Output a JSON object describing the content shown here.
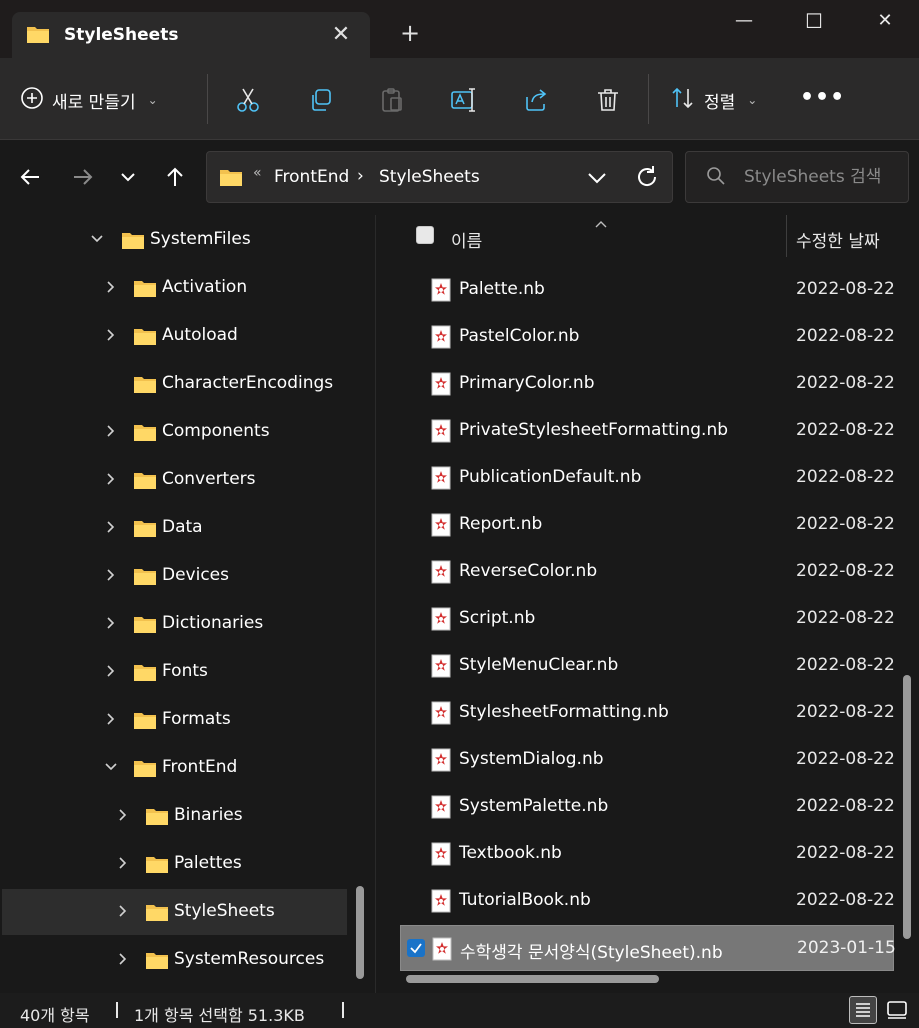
{
  "window": {
    "tab_title": "StyleSheets",
    "tab_close": "✕",
    "new_tab": "+",
    "minimize": "—",
    "maximize": "☐",
    "close": "✕"
  },
  "toolbar": {
    "new_label": "새로 만들기",
    "sort_label": "정렬",
    "more_label": "•••"
  },
  "address": {
    "chevron": "«",
    "crumbs": [
      "FrontEnd",
      "StyleSheets"
    ],
    "separator": "›"
  },
  "search": {
    "placeholder": "StyleSheets 검색"
  },
  "nav_tree": [
    {
      "label": "SystemFiles",
      "level": 0,
      "expanded": true
    },
    {
      "label": "Activation",
      "level": 1,
      "expanded": false
    },
    {
      "label": "Autoload",
      "level": 1,
      "expanded": false
    },
    {
      "label": "CharacterEncodings",
      "level": 1,
      "expanded": null
    },
    {
      "label": "Components",
      "level": 1,
      "expanded": false
    },
    {
      "label": "Converters",
      "level": 1,
      "expanded": false
    },
    {
      "label": "Data",
      "level": 1,
      "expanded": false
    },
    {
      "label": "Devices",
      "level": 1,
      "expanded": false
    },
    {
      "label": "Dictionaries",
      "level": 1,
      "expanded": false
    },
    {
      "label": "Fonts",
      "level": 1,
      "expanded": false
    },
    {
      "label": "Formats",
      "level": 1,
      "expanded": false
    },
    {
      "label": "FrontEnd",
      "level": 1,
      "expanded": true
    },
    {
      "label": "Binaries",
      "level": 2,
      "expanded": false
    },
    {
      "label": "Palettes",
      "level": 2,
      "expanded": false
    },
    {
      "label": "StyleSheets",
      "level": 2,
      "expanded": false,
      "selected": true
    },
    {
      "label": "SystemResources",
      "level": 2,
      "expanded": false
    }
  ],
  "columns": {
    "name": "이름",
    "date": "수정한 날짜"
  },
  "files": [
    {
      "name": "Palette.nb",
      "date": "2022-08-22"
    },
    {
      "name": "PastelColor.nb",
      "date": "2022-08-22"
    },
    {
      "name": "PrimaryColor.nb",
      "date": "2022-08-22"
    },
    {
      "name": "PrivateStylesheetFormatting.nb",
      "date": "2022-08-22"
    },
    {
      "name": "PublicationDefault.nb",
      "date": "2022-08-22"
    },
    {
      "name": "Report.nb",
      "date": "2022-08-22"
    },
    {
      "name": "ReverseColor.nb",
      "date": "2022-08-22"
    },
    {
      "name": "Script.nb",
      "date": "2022-08-22"
    },
    {
      "name": "StyleMenuClear.nb",
      "date": "2022-08-22"
    },
    {
      "name": "StylesheetFormatting.nb",
      "date": "2022-08-22"
    },
    {
      "name": "SystemDialog.nb",
      "date": "2022-08-22"
    },
    {
      "name": "SystemPalette.nb",
      "date": "2022-08-22"
    },
    {
      "name": "Textbook.nb",
      "date": "2022-08-22"
    },
    {
      "name": "TutorialBook.nb",
      "date": "2022-08-22"
    },
    {
      "name": "수학생각 문서양식(StyleSheet).nb",
      "date": "2023-01-15",
      "selected": true
    }
  ],
  "status": {
    "item_count": "40개 항목",
    "selection": "1개 항목 선택함 51.3KB"
  },
  "colors": {
    "folder": "#f2c14e",
    "accent": "#1a73c8",
    "icon_blue": "#4fc3f7",
    "nb_red": "#d32f2f"
  }
}
